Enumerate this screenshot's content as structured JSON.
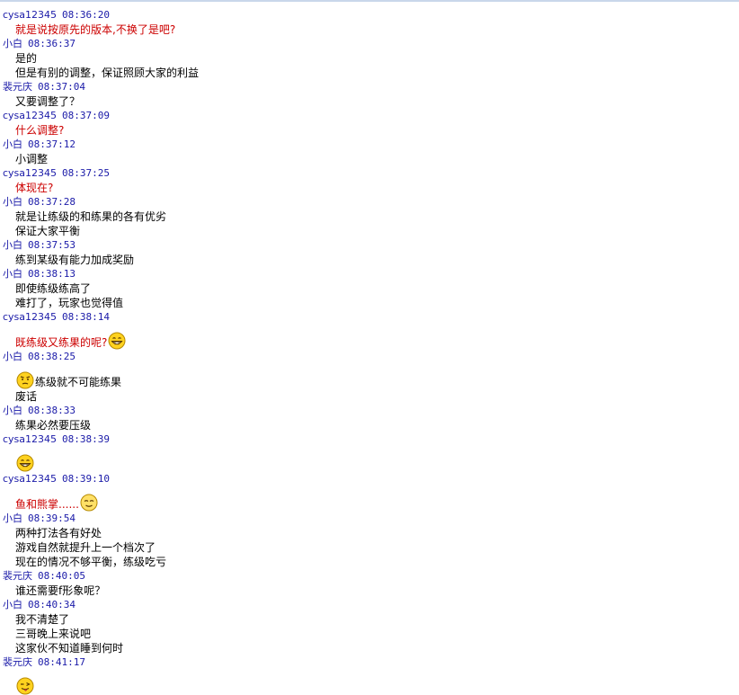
{
  "messages": [
    {
      "sender": "cysa12345",
      "time": "08:36:20",
      "lines": [
        {
          "text": "就是说按原先的版本,不换了是吧?",
          "color": "red"
        }
      ]
    },
    {
      "sender": "小白",
      "time": "08:36:37",
      "lines": [
        {
          "text": "是的",
          "color": "black"
        },
        {
          "text": "但是有别的调整，保证照顾大家的利益",
          "color": "black"
        }
      ]
    },
    {
      "sender": "裴元庆",
      "time": "08:37:04",
      "lines": [
        {
          "text": "又要调整了？",
          "color": "black"
        }
      ]
    },
    {
      "sender": "cysa12345",
      "time": "08:37:09",
      "lines": [
        {
          "text": "什么调整?",
          "color": "red"
        }
      ]
    },
    {
      "sender": "小白",
      "time": "08:37:12",
      "lines": [
        {
          "text": "小调整",
          "color": "black"
        }
      ]
    },
    {
      "sender": "cysa12345",
      "time": "08:37:25",
      "lines": [
        {
          "text": "体现在?",
          "color": "red"
        }
      ]
    },
    {
      "sender": "小白",
      "time": "08:37:28",
      "lines": [
        {
          "text": "就是让练级的和练果的各有优劣",
          "color": "black"
        },
        {
          "text": "保证大家平衡",
          "color": "black"
        }
      ]
    },
    {
      "sender": "小白",
      "time": "08:37:53",
      "lines": [
        {
          "text": "练到某级有能力加成奖励",
          "color": "black"
        }
      ]
    },
    {
      "sender": "小白",
      "time": "08:38:13",
      "lines": [
        {
          "text": "即使练级练高了",
          "color": "black"
        },
        {
          "text": "难打了，玩家也觉得值",
          "color": "black"
        }
      ]
    },
    {
      "sender": "cysa12345",
      "time": "08:38:14",
      "lines": [
        {
          "text": "既练级又练果的呢?",
          "color": "red",
          "emoji_after": "grin-icon"
        }
      ]
    },
    {
      "sender": "小白",
      "time": "08:38:25",
      "lines": [
        {
          "text": "练级就不可能练果",
          "color": "black",
          "emoji_before": "puzzled-icon"
        },
        {
          "text": "废话",
          "color": "black"
        }
      ]
    },
    {
      "sender": "小白",
      "time": "08:38:33",
      "lines": [
        {
          "text": "练果必然要压级",
          "color": "black"
        }
      ]
    },
    {
      "sender": "cysa12345",
      "time": "08:38:39",
      "lines": [
        {
          "text": "",
          "color": "red",
          "emoji_before": "grin-icon"
        }
      ]
    },
    {
      "sender": "cysa12345",
      "time": "08:39:10",
      "lines": [
        {
          "text": "鱼和熊掌......",
          "color": "red",
          "emoji_after": "smug-icon"
        }
      ]
    },
    {
      "sender": "小白",
      "time": "08:39:54",
      "lines": [
        {
          "text": "两种打法各有好处",
          "color": "black"
        },
        {
          "text": "游戏自然就提升上一个档次了",
          "color": "black"
        },
        {
          "text": "现在的情况不够平衡，练级吃亏",
          "color": "black"
        }
      ]
    },
    {
      "sender": "裴元庆",
      "time": "08:40:05",
      "lines": [
        {
          "text": "谁还需要f形象呢？",
          "color": "black"
        }
      ]
    },
    {
      "sender": "小白",
      "time": "08:40:34",
      "lines": [
        {
          "text": "我不清楚了",
          "color": "black"
        },
        {
          "text": "三哥晚上来说吧",
          "color": "black"
        },
        {
          "text": "这家伙不知道睡到何时",
          "color": "black"
        }
      ]
    },
    {
      "sender": "裴元庆",
      "time": "08:41:17",
      "lines": [
        {
          "text": "",
          "color": "black",
          "emoji_before": "wink-tongue-icon"
        }
      ]
    }
  ]
}
